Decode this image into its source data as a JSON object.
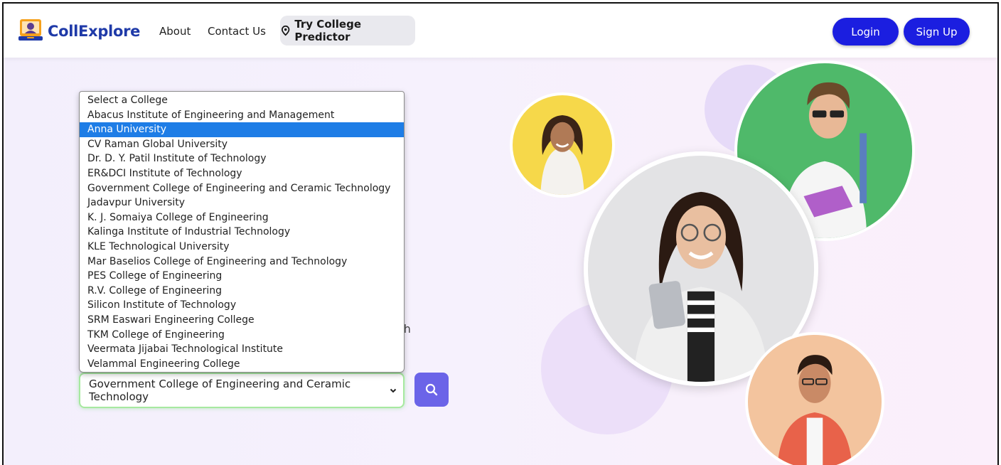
{
  "navbar": {
    "brand": "CollExplore",
    "links": [
      "About",
      "Contact Us"
    ],
    "predictor_label": "Try College Predictor",
    "login_label": "Login",
    "signup_label": "Sign Up"
  },
  "hero": {
    "partial_text": "ch"
  },
  "college_select": {
    "current_value": "Government College of Engineering and Ceramic Technology",
    "highlighted_index": 2,
    "options": [
      "Select a College",
      "Abacus Institute of Engineering and Management",
      "Anna University",
      "CV Raman Global University",
      "Dr. D. Y. Patil Institute of Technology",
      "ER&DCI Institute of Technology",
      "Government College of Engineering and Ceramic Technology",
      "Jadavpur University",
      "K. J. Somaiya College of Engineering",
      "Kalinga Institute of Industrial Technology",
      "KLE Technological University",
      "Mar Baselios College of Engineering and Technology",
      "PES College of Engineering",
      "R.V. College of Engineering",
      "Silicon Institute of Technology",
      "SRM Easwari Engineering College",
      "TKM College of Engineering",
      "Veermata Jijabai Technological Institute",
      "Velammal Engineering College"
    ]
  },
  "colors": {
    "brand": "#1f3aa8",
    "auth_button": "#1b1ee0",
    "search_button": "#6b64e8",
    "option_highlight": "#1e7de6",
    "select_border": "#a7e9a0"
  },
  "icons": {
    "logo": "laptop-graduate-logo-icon",
    "predictor": "location-pin-icon",
    "search": "search-icon",
    "caret": "chevron-down-icon"
  }
}
